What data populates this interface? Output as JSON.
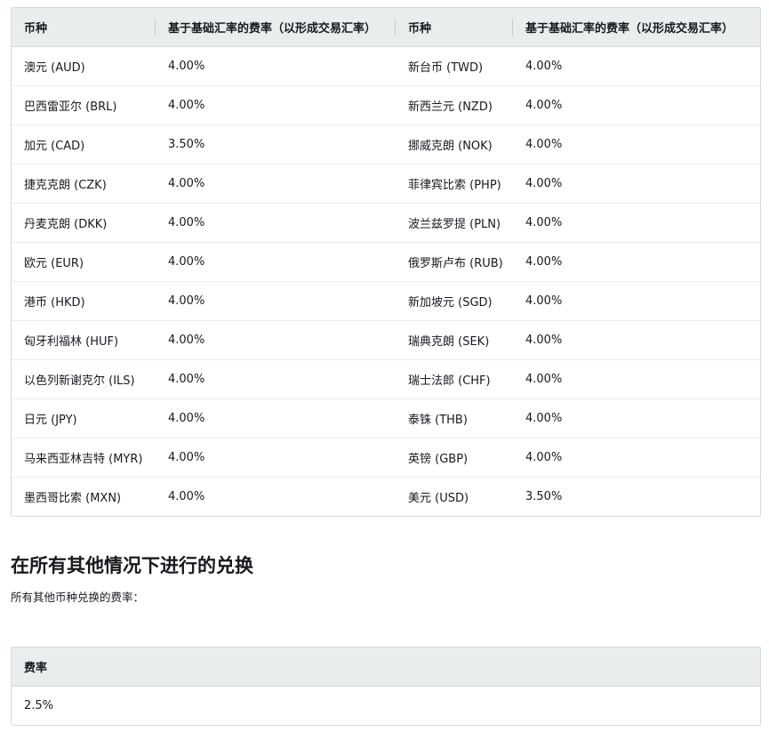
{
  "rates_table": {
    "headers": [
      "币种",
      "基于基础汇率的费率（以形成交易汇率）",
      "币种",
      "基于基础汇率的费率（以形成交易汇率）"
    ],
    "rows": [
      [
        "澳元 (AUD)",
        "4.00%",
        "新台币 (TWD)",
        "4.00%"
      ],
      [
        "巴西雷亚尔 (BRL)",
        "4.00%",
        "新西兰元 (NZD)",
        "4.00%"
      ],
      [
        "加元 (CAD)",
        "3.50%",
        "挪威克朗 (NOK)",
        "4.00%"
      ],
      [
        "捷克克朗 (CZK)",
        "4.00%",
        "菲律宾比索 (PHP)",
        "4.00%"
      ],
      [
        "丹麦克朗 (DKK)",
        "4.00%",
        "波兰兹罗提 (PLN)",
        "4.00%"
      ],
      [
        "欧元 (EUR)",
        "4.00%",
        "俄罗斯卢布 (RUB)",
        "4.00%"
      ],
      [
        "港币 (HKD)",
        "4.00%",
        "新加坡元 (SGD)",
        "4.00%"
      ],
      [
        "匈牙利福林 (HUF)",
        "4.00%",
        "瑞典克朗 (SEK)",
        "4.00%"
      ],
      [
        "以色列新谢克尔 (ILS)",
        "4.00%",
        "瑞士法郎 (CHF)",
        "4.00%"
      ],
      [
        "日元 (JPY)",
        "4.00%",
        "泰铢 (THB)",
        "4.00%"
      ],
      [
        "马来西亚林吉特 (MYR)",
        "4.00%",
        "英镑 (GBP)",
        "4.00%"
      ],
      [
        "墨西哥比索 (MXN)",
        "4.00%",
        "美元 (USD)",
        "3.50%"
      ]
    ]
  },
  "other_section": {
    "heading": "在所有其他情况下进行的兑换",
    "description": "所有其他币种兑换的费率："
  },
  "other_table": {
    "header": "费率",
    "value": "2.5%"
  }
}
